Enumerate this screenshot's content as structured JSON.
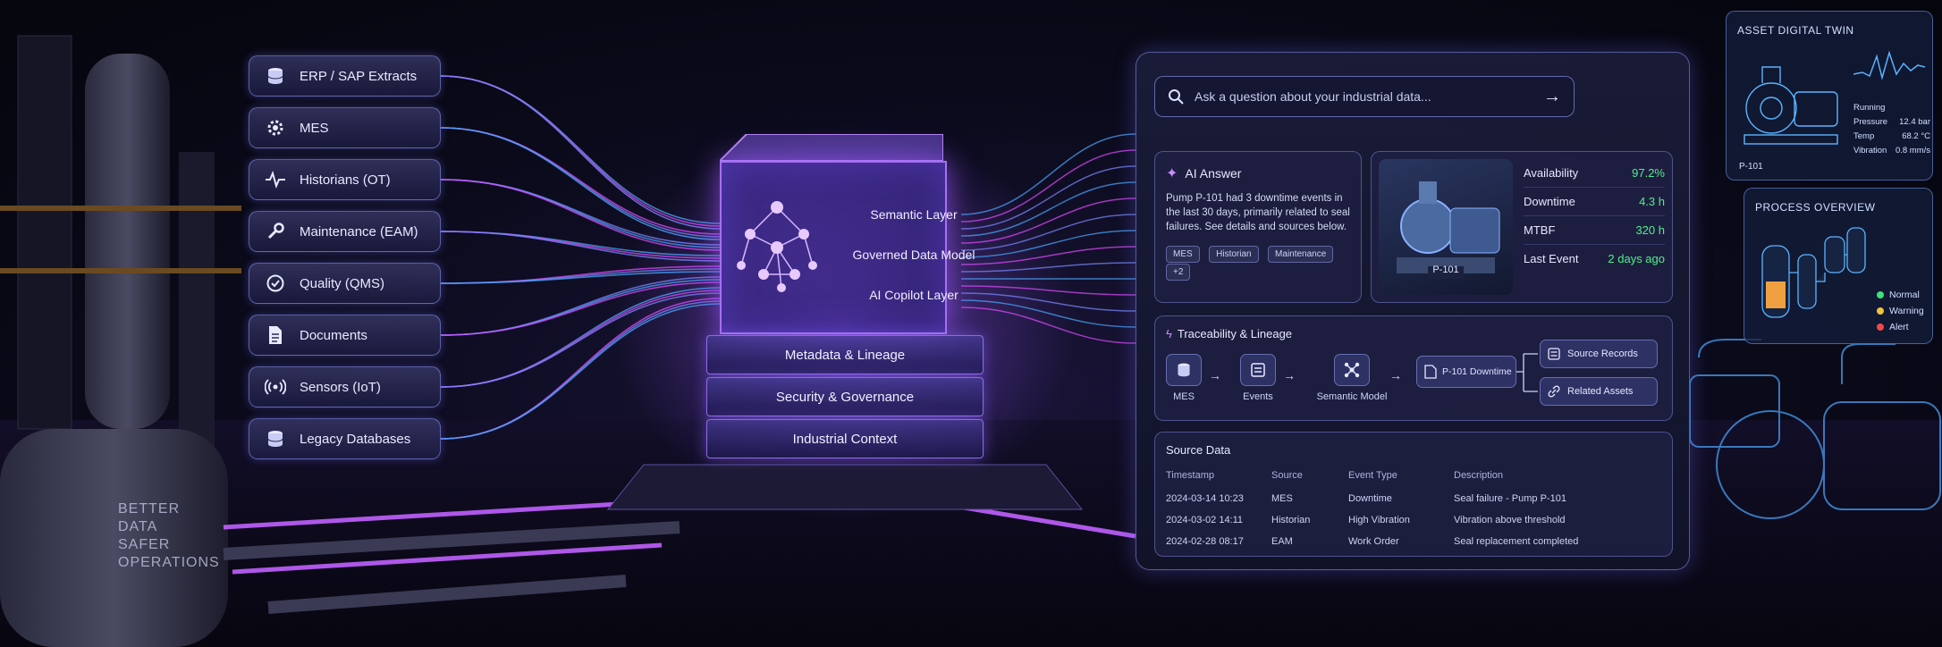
{
  "sources": [
    {
      "label": "ERP / SAP Extracts",
      "icon": "database-icon"
    },
    {
      "label": "MES",
      "icon": "gear-icon"
    },
    {
      "label": "Historians (OT)",
      "icon": "pulse-icon"
    },
    {
      "label": "Maintenance (EAM)",
      "icon": "wrench-icon"
    },
    {
      "label": "Quality (QMS)",
      "icon": "check-circle-icon"
    },
    {
      "label": "Documents",
      "icon": "document-icon"
    },
    {
      "label": "Sensors (IoT)",
      "icon": "signal-icon"
    },
    {
      "label": "Legacy Databases",
      "icon": "database-icon"
    }
  ],
  "cube": {
    "layers": [
      "Semantic Layer",
      "Governed Data Model",
      "AI Copilot Layer"
    ],
    "slabs": [
      "Metadata & Lineage",
      "Security & Governance",
      "Industrial Context"
    ]
  },
  "tank": {
    "lines": [
      "BETTER",
      "DATA",
      "SAFER",
      "OPERATIONS"
    ]
  },
  "panel": {
    "search_placeholder": "Ask a question about your industrial data...",
    "ai_answer": {
      "title": "AI Answer",
      "text": "Pump P-101 had 3 downtime events in the last 30 days, primarily related to seal failures. See details and sources below.",
      "chips": [
        "MES",
        "Historian",
        "Maintenance",
        "+2"
      ]
    },
    "asset_image_label": "P-101",
    "metrics": [
      {
        "label": "Availability",
        "value": "97.2%"
      },
      {
        "label": "Downtime",
        "value": "4.3 h"
      },
      {
        "label": "MTBF",
        "value": "320 h"
      },
      {
        "label": "Last Event",
        "value": "2 days ago"
      }
    ],
    "traceability": {
      "title": "Traceability & Lineage",
      "nodes": [
        "MES",
        "Events",
        "Semantic Model",
        "P-101 Downtime"
      ],
      "outputs": [
        "Source Records",
        "Related Assets"
      ]
    },
    "source_data": {
      "title": "Source Data",
      "headers": [
        "Timestamp",
        "Source",
        "Event Type",
        "Description"
      ],
      "rows": [
        [
          "2024-03-14 10:23",
          "MES",
          "Downtime",
          "Seal failure - Pump P-101"
        ],
        [
          "2024-03-02 14:11",
          "Historian",
          "High Vibration",
          "Vibration above threshold"
        ],
        [
          "2024-02-28 08:17",
          "EAM",
          "Work Order",
          "Seal replacement completed"
        ]
      ]
    }
  },
  "twin": {
    "title": "ASSET DIGITAL TWIN",
    "status": "Running",
    "pump_label": "P-101",
    "readings": [
      {
        "label": "Pressure",
        "value": "12.4 bar"
      },
      {
        "label": "Temp",
        "value": "68.2 °C"
      },
      {
        "label": "Vibration",
        "value": "0.8 mm/s"
      }
    ]
  },
  "process": {
    "title": "PROCESS OVERVIEW",
    "legend": [
      {
        "label": "Normal",
        "color": "#3ee07a"
      },
      {
        "label": "Warning",
        "color": "#f0c23a"
      },
      {
        "label": "Alert",
        "color": "#f04a4a"
      }
    ]
  },
  "colors": {
    "accent": "#9a6bff",
    "flow_blue": "#4aa8ff",
    "flow_pink": "#e04aff",
    "ok_green": "#4ef08a"
  }
}
